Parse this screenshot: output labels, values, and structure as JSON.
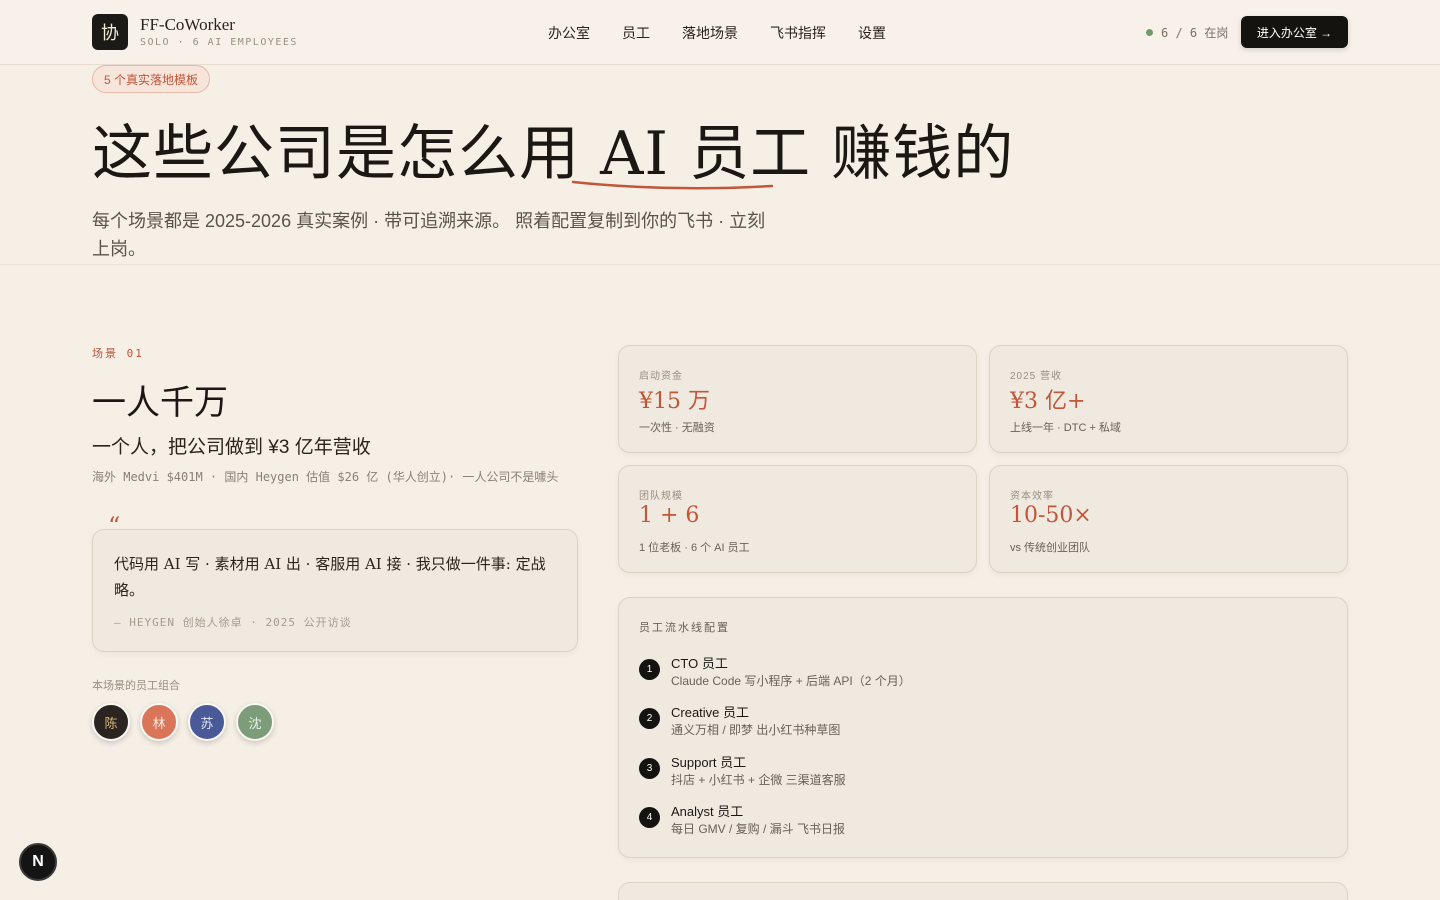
{
  "header": {
    "logo_char": "协",
    "app_name": "FF-CoWorker",
    "app_sub": "SOLO · 6 AI EMPLOYEES",
    "nav": [
      "办公室",
      "员工",
      "落地场景",
      "飞书指挥",
      "设置"
    ],
    "status_text": "6 / 6 在岗",
    "status_color": "#6f9a6c",
    "cta": "进入办公室 →"
  },
  "hero": {
    "badge": "5 个真实落地模板",
    "title": "这些公司是怎么用 AI 员工 赚钱的",
    "subtitle": "每个场景都是 2025-2026 真实案例 · 带可追溯来源。 照着配置复制到你的飞书 · 立刻上岗。",
    "accent": "#c0563a"
  },
  "scene": {
    "label": "场景 01",
    "title": "一人千万",
    "subtitle": "一个人，把公司做到 ¥3 亿年营收",
    "desc": "海外 Medvi $401M · 国内 Heygen 估值 $26 亿 (华人创立)· 一人公司不是噱头",
    "quote_mark": "“",
    "quote": "代码用 AI 写 · 素材用 AI 出 · 客服用 AI 接 · 我只做一件事: 定战略。",
    "quote_source": "— HEYGEN 创始人徐卓 · 2025 公开访谈",
    "team_label": "本场景的员工组合",
    "team": [
      {
        "char": "陈",
        "bg": "#2a2520",
        "fg": "#d9b77a"
      },
      {
        "char": "林",
        "bg": "#d9765a",
        "fg": "#fde9df"
      },
      {
        "char": "苏",
        "bg": "#4a5a98",
        "fg": "#e3e7f7"
      },
      {
        "char": "沈",
        "bg": "#7c9c7a",
        "fg": "#eaf2e6"
      }
    ]
  },
  "stats": [
    {
      "label": "启动资金",
      "value": "¥15 万",
      "note": "一次性 · 无融资"
    },
    {
      "label": "2025 营收",
      "value": "¥3 亿+",
      "note": "上线一年 · DTC + 私域"
    },
    {
      "label": "团队规模",
      "value": "1 + 6",
      "note": "1 位老板 · 6 个 AI 员工"
    },
    {
      "label": "资本效率",
      "value": "10-50×",
      "note": "vs 传统创业团队"
    }
  ],
  "pipeline": {
    "title": "员工流水线配置",
    "steps": [
      {
        "num": "1",
        "name": "CTO 员工",
        "desc": "Claude Code 写小程序 + 后端 API（2 个月）"
      },
      {
        "num": "2",
        "name": "Creative 员工",
        "desc": "通义万相 / 即梦 出小红书种草图"
      },
      {
        "num": "3",
        "name": "Support 员工",
        "desc": "抖店 + 小红书 + 企微 三渠道客服"
      },
      {
        "num": "4",
        "name": "Analyst 员工",
        "desc": "每日 GMV / 复购 / 漏斗 飞书日报"
      }
    ]
  },
  "floating": {
    "n_label": "N"
  }
}
